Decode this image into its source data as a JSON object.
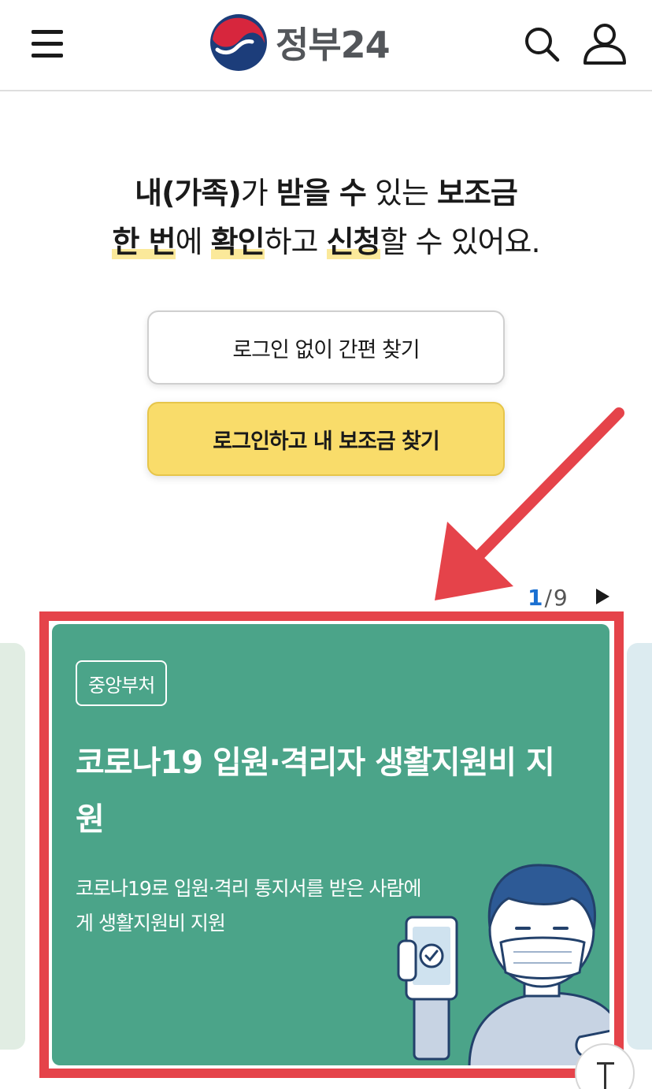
{
  "header": {
    "logo_text": "정부24",
    "menu_icon": "hamburger-menu-icon",
    "search_icon": "search-icon",
    "user_icon": "user-icon"
  },
  "hero": {
    "line1": {
      "part1": "내(가족)",
      "part2": "가 ",
      "part3": "받을 수",
      "part4": " 있는 ",
      "part5": "보조금"
    },
    "line2": {
      "part1": "한 번",
      "part2": "에 ",
      "part3": "확인",
      "part4": "하고 ",
      "part5": "신청",
      "part6": "할 수 있어요."
    }
  },
  "buttons": {
    "no_login": "로그인 없이 간편 찾기",
    "login": "로그인하고 내 보조금 찾기"
  },
  "pager": {
    "current": "1",
    "separator": "/",
    "total": "9",
    "next_icon": "play-next-icon"
  },
  "card": {
    "tag": "중앙부처",
    "title": "코로나19 입원·격리자 생활지원비 지원",
    "description": "코로나19로 입원·격리 통지서를 받은 사람에게 생활지원비 지원"
  },
  "colors": {
    "accent_yellow": "#f9dc6a",
    "card_green": "#4ba489",
    "highlight_red": "#e5434a",
    "pager_blue": "#1a6fd1"
  }
}
